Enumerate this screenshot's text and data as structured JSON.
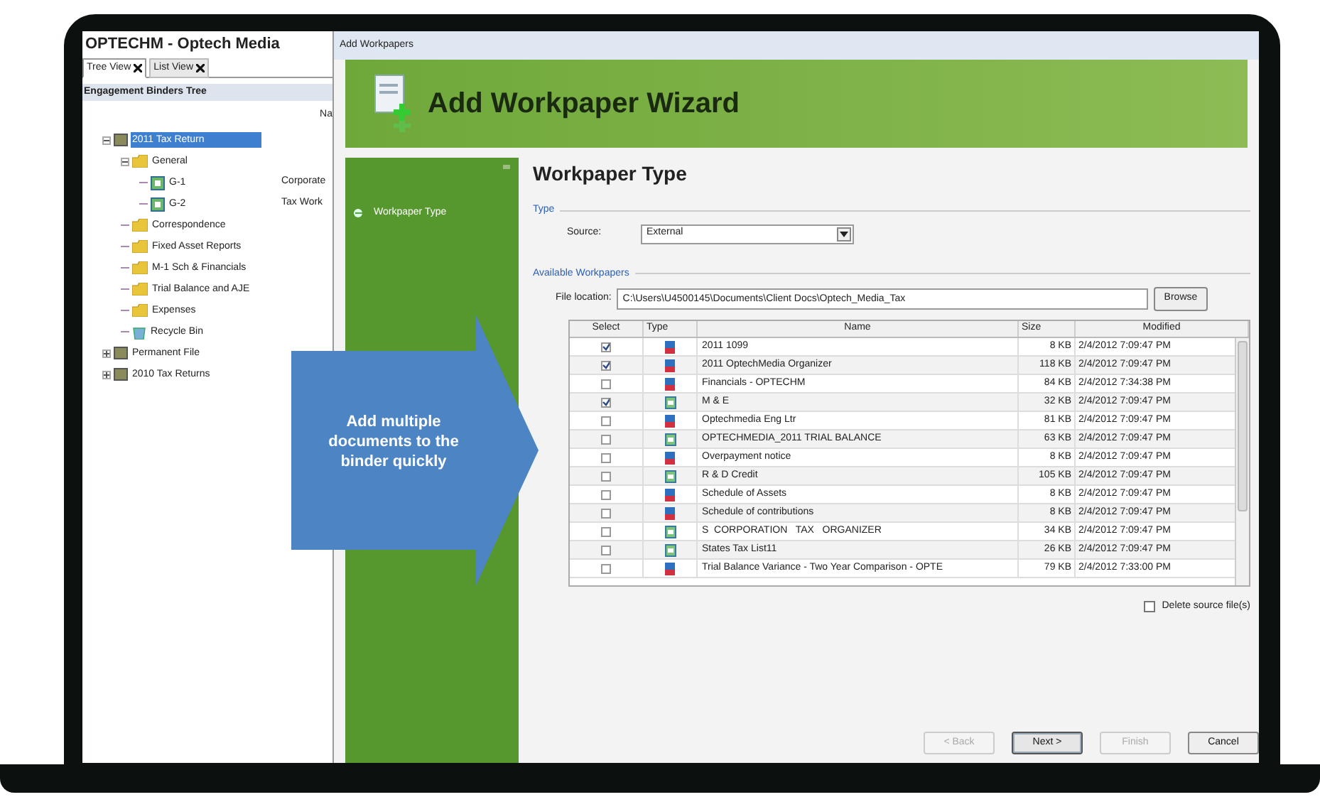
{
  "app": {
    "title": "OPTECHM - Optech Media",
    "tabs": [
      {
        "label": "Tree View",
        "selected": true
      },
      {
        "label": "List View",
        "selected": false
      }
    ],
    "panel_title": "Engagement Binders Tree",
    "column_header": "Na",
    "tree": [
      {
        "label": "2011 Tax Return",
        "kind": "binder",
        "selected": true,
        "expanded": true,
        "children": [
          {
            "label": "General",
            "kind": "folder",
            "selected": false,
            "expanded": true,
            "children": [
              {
                "label": "G-1",
                "kind": "sheet",
                "selected": false,
                "description": "Corporate"
              },
              {
                "label": "G-2",
                "kind": "sheet",
                "selected": false,
                "description": "Tax Work"
              }
            ]
          },
          {
            "label": "Correspondence",
            "kind": "folder",
            "selected": false
          },
          {
            "label": "Fixed Asset Reports",
            "kind": "folder",
            "selected": false
          },
          {
            "label": "M-1 Sch & Financials",
            "kind": "folder",
            "selected": false
          },
          {
            "label": "Trial Balance and AJE",
            "kind": "folder",
            "selected": false
          },
          {
            "label": "Expenses",
            "kind": "folder",
            "selected": false
          },
          {
            "label": "Recycle Bin",
            "kind": "bin",
            "selected": false
          }
        ]
      },
      {
        "label": "Permanent File",
        "kind": "binder",
        "selected": false,
        "expanded": false
      },
      {
        "label": "2010 Tax Returns",
        "kind": "binder",
        "selected": false,
        "expanded": false
      }
    ]
  },
  "dialog": {
    "title": "Add Workpapers",
    "wizard_title": "Add Workpaper Wizard",
    "steps": [
      {
        "label": "Workpaper Type",
        "selected": true
      }
    ],
    "page_title": "Workpaper Type",
    "type_group": "Type",
    "source_label": "Source:",
    "source_value": "External",
    "available_group": "Available Workpapers",
    "file_location_label": "File location:",
    "file_location": "C:\\Users\\U4500145\\Documents\\Client Docs\\Optech_Media_Tax",
    "browse": "Browse",
    "table": {
      "columns": [
        "Select",
        "Type",
        "Name",
        "Size",
        "Modified"
      ],
      "rows": [
        {
          "checked": true,
          "kind": "document",
          "name": "2011 1099",
          "size": "8 KB",
          "modified": "2/4/2012 7:09:47 PM"
        },
        {
          "checked": true,
          "kind": "document",
          "name": "2011 OptechMedia Organizer",
          "size": "118 KB",
          "modified": "2/4/2012 7:09:47 PM"
        },
        {
          "checked": false,
          "kind": "document",
          "name": "Financials - OPTECHM",
          "size": "84 KB",
          "modified": "2/4/2012 7:34:38 PM"
        },
        {
          "checked": true,
          "kind": "spreadsheet",
          "name": "M & E",
          "size": "32 KB",
          "modified": "2/4/2012 7:09:47 PM"
        },
        {
          "checked": false,
          "kind": "document",
          "name": "Optechmedia Eng Ltr",
          "size": "81 KB",
          "modified": "2/4/2012 7:09:47 PM"
        },
        {
          "checked": false,
          "kind": "spreadsheet",
          "name": "OPTECHMEDIA_2011 TRIAL BALANCE",
          "size": "63 KB",
          "modified": "2/4/2012 7:09:47 PM"
        },
        {
          "checked": false,
          "kind": "document",
          "name": "Overpayment notice",
          "size": "8 KB",
          "modified": "2/4/2012 7:09:47 PM"
        },
        {
          "checked": false,
          "kind": "spreadsheet",
          "name": "R & D Credit",
          "size": "105 KB",
          "modified": "2/4/2012 7:09:47 PM"
        },
        {
          "checked": false,
          "kind": "document",
          "name": "Schedule of Assets",
          "size": "8 KB",
          "modified": "2/4/2012 7:09:47 PM"
        },
        {
          "checked": false,
          "kind": "document",
          "name": "Schedule of contributions",
          "size": "8 KB",
          "modified": "2/4/2012 7:09:47 PM"
        },
        {
          "checked": false,
          "kind": "spreadsheet",
          "name": "S  CORPORATION   TAX   ORGANIZER",
          "size": "34 KB",
          "modified": "2/4/2012 7:09:47 PM"
        },
        {
          "checked": false,
          "kind": "spreadsheet",
          "name": "States Tax List11",
          "size": "26 KB",
          "modified": "2/4/2012 7:09:47 PM"
        },
        {
          "checked": false,
          "kind": "document",
          "name": "Trial Balance Variance - Two Year Comparison - OPTE",
          "size": "79 KB",
          "modified": "2/4/2012 7:33:00 PM"
        }
      ]
    },
    "delete_source": {
      "label": "Delete source file(s)",
      "checked": false
    },
    "buttons": [
      {
        "label": "< Back",
        "disabled": true,
        "default": false
      },
      {
        "label": "Next >",
        "disabled": false,
        "default": true
      },
      {
        "label": "Finish",
        "disabled": true,
        "default": false
      },
      {
        "label": "Cancel",
        "disabled": false,
        "default": false
      }
    ]
  },
  "callout": {
    "text": "Add multiple documents to the binder quickly"
  }
}
